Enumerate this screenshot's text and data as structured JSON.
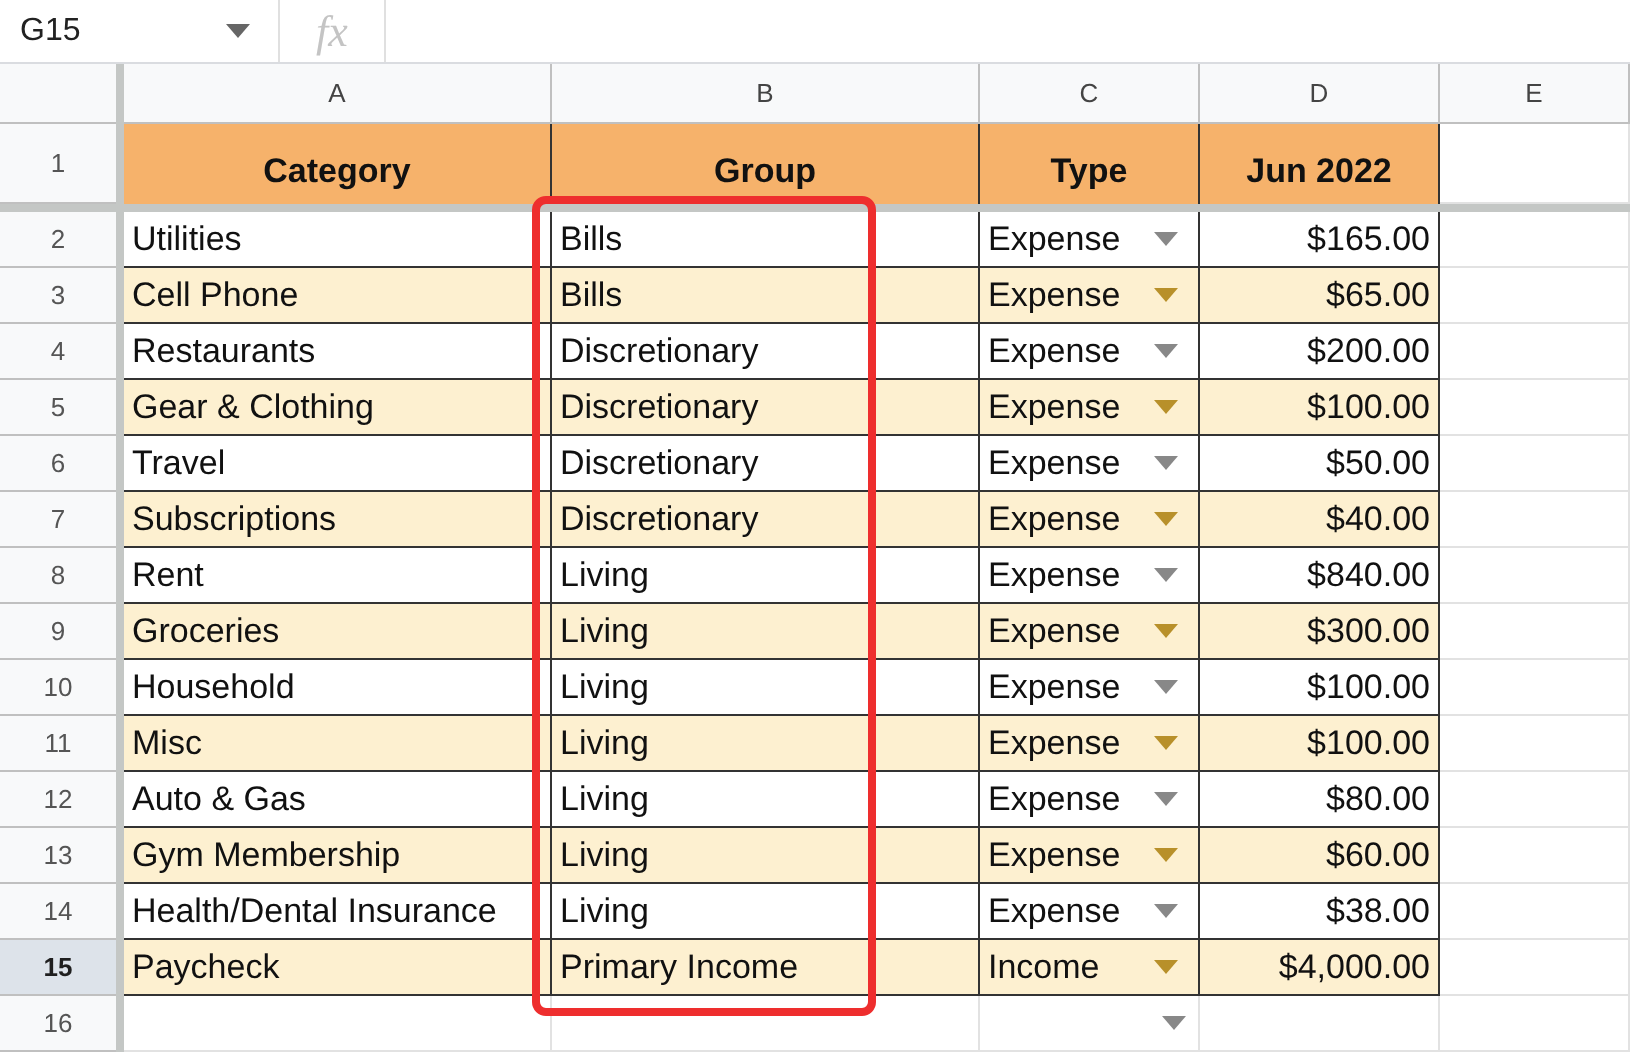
{
  "formula_bar": {
    "cell_reference": "G15",
    "fx_label": "fx"
  },
  "column_headers": [
    "A",
    "B",
    "C",
    "D",
    "E"
  ],
  "header_row": {
    "number": "1",
    "cells": [
      "Category",
      "Group",
      "Type",
      "Jun 2022"
    ]
  },
  "rows": [
    {
      "number": "2",
      "category": "Utilities",
      "group": "Bills",
      "type": "Expense",
      "amount": "$165.00",
      "shaded": false,
      "selected": false
    },
    {
      "number": "3",
      "category": "Cell Phone",
      "group": "Bills",
      "type": "Expense",
      "amount": "$65.00",
      "shaded": true,
      "selected": false
    },
    {
      "number": "4",
      "category": "Restaurants",
      "group": "Discretionary",
      "type": "Expense",
      "amount": "$200.00",
      "shaded": false,
      "selected": false
    },
    {
      "number": "5",
      "category": "Gear & Clothing",
      "group": "Discretionary",
      "type": "Expense",
      "amount": "$100.00",
      "shaded": true,
      "selected": false
    },
    {
      "number": "6",
      "category": "Travel",
      "group": "Discretionary",
      "type": "Expense",
      "amount": "$50.00",
      "shaded": false,
      "selected": false
    },
    {
      "number": "7",
      "category": "Subscriptions",
      "group": "Discretionary",
      "type": "Expense",
      "amount": "$40.00",
      "shaded": true,
      "selected": false
    },
    {
      "number": "8",
      "category": "Rent",
      "group": "Living",
      "type": "Expense",
      "amount": "$840.00",
      "shaded": false,
      "selected": false
    },
    {
      "number": "9",
      "category": "Groceries",
      "group": "Living",
      "type": "Expense",
      "amount": "$300.00",
      "shaded": true,
      "selected": false
    },
    {
      "number": "10",
      "category": "Household",
      "group": "Living",
      "type": "Expense",
      "amount": "$100.00",
      "shaded": false,
      "selected": false
    },
    {
      "number": "11",
      "category": "Misc",
      "group": "Living",
      "type": "Expense",
      "amount": "$100.00",
      "shaded": true,
      "selected": false
    },
    {
      "number": "12",
      "category": "Auto & Gas",
      "group": "Living",
      "type": "Expense",
      "amount": "$80.00",
      "shaded": false,
      "selected": false
    },
    {
      "number": "13",
      "category": "Gym Membership",
      "group": "Living",
      "type": "Expense",
      "amount": "$60.00",
      "shaded": true,
      "selected": false
    },
    {
      "number": "14",
      "category": "Health/Dental Insurance",
      "group": "Living",
      "type": "Expense",
      "amount": "$38.00",
      "shaded": false,
      "selected": false
    },
    {
      "number": "15",
      "category": "Paycheck",
      "group": "Primary Income",
      "type": "Income",
      "amount": "$4,000.00",
      "shaded": true,
      "selected": true
    }
  ],
  "empty_row": {
    "number": "16"
  }
}
